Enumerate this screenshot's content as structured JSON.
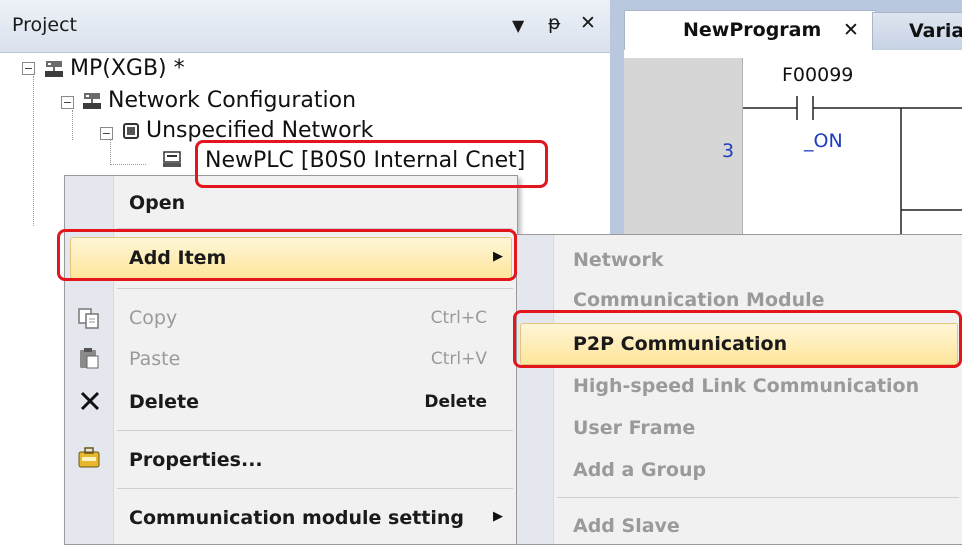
{
  "project_panel": {
    "title": "Project",
    "dropdown_glyph": "▼",
    "pin_glyph": "ᵽ",
    "close_glyph": "✕",
    "tree": {
      "root": "MP(XGB) *",
      "network_configuration": "Network Configuration",
      "unspecified_network": "Unspecified Network",
      "plc": "NewPLC [B0S0 Internal Cnet]"
    }
  },
  "editor": {
    "tab_active": "NewProgram",
    "tab_close": "✕",
    "tab_inactive": "Varia",
    "line_number": "3",
    "contact_address": "F00099",
    "contact_name": "_ON"
  },
  "context_menu": {
    "items": [
      {
        "label": "Open"
      },
      {
        "label": "Add Item",
        "submenu_arrow": "▶"
      },
      {
        "label": "Copy",
        "shortcut": "Ctrl+C",
        "icon": "copy-icon"
      },
      {
        "label": "Paste",
        "shortcut": "Ctrl+V",
        "icon": "paste-icon"
      },
      {
        "label": "Delete",
        "shortcut": "Delete",
        "icon": "delete-icon"
      },
      {
        "label": "Properties...",
        "icon": "properties-icon"
      },
      {
        "label": "Communication module setting",
        "submenu_arrow": "▶"
      }
    ]
  },
  "submenu": {
    "items": [
      {
        "label": "Network"
      },
      {
        "label": "Communication Module"
      },
      {
        "label": "P2P Communication"
      },
      {
        "label": "High-speed Link Communication"
      },
      {
        "label": "User Frame"
      },
      {
        "label": "Add a Group"
      },
      {
        "label": "Add Slave"
      }
    ]
  },
  "colors": {
    "highlight_box": "#e3161d",
    "menu_hover": "#fde59a",
    "editor_background": "#b9c8de"
  }
}
